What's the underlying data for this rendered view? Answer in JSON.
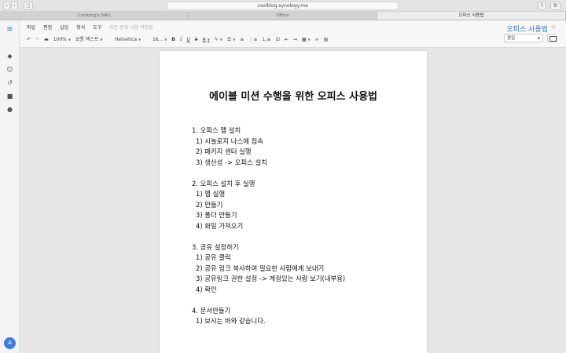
{
  "browser": {
    "url": "coolblog.synology.me",
    "tabs": [
      {
        "label": "Coolblog's NAS"
      },
      {
        "label": "Office"
      },
      {
        "label": "오피스 사용법"
      }
    ]
  },
  "app": {
    "menu": [
      "파일",
      "편집",
      "삽입",
      "형식",
      "도구"
    ],
    "save_status": "모든 변경 사항 저장됨",
    "doc_title": "오피스 사용법",
    "mode": "편집",
    "avatar_initial": "A"
  },
  "toolbar": {
    "zoom": "100%",
    "style": "보통 텍스트",
    "font": "Helvetica",
    "size": "16...",
    "bold": "B",
    "italic": "I",
    "underline": "U",
    "strike": "S",
    "font_color": "A"
  },
  "document": {
    "heading": "에이블 미션 수행을 위한 오피스 사용법",
    "sections": [
      {
        "title": "1. 오피스 앱 설치",
        "items": [
          "1) 시놀로지 나스에 접속",
          "2) 패키지 센터 실행",
          "3) 생산성 -> 오피스 설치"
        ]
      },
      {
        "title": "2. 오피스 설치 후 실행",
        "items": [
          "1) 앱 실행",
          "2) 만들기",
          "3) 폴더 만들기",
          "4) 화일 가져오기"
        ]
      },
      {
        "title": "3. 공유 설정하기",
        "items": [
          "1) 공유 클릭",
          "2) 공유 링크 복사하여 필요한 사람에게 보내기",
          "3) 공유링크 권한 설정 -> 계정있는 사람 보기(내부용)",
          "4) 확인"
        ]
      },
      {
        "title": "4. 문서만들기",
        "items": [
          "1) 보시는 바와 같습니다."
        ]
      }
    ]
  },
  "colors": {
    "accent": "#3b75d6",
    "avatar_bg": "#3b7de0"
  }
}
